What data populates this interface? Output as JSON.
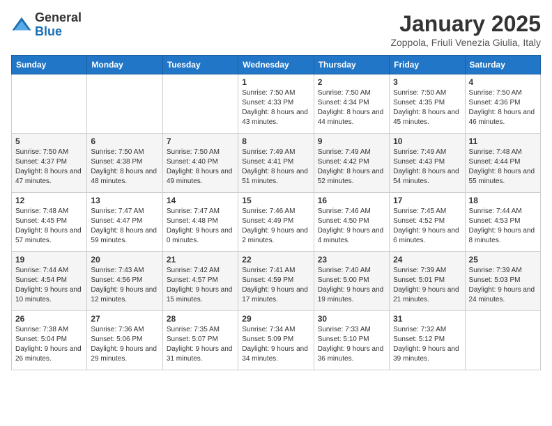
{
  "logo": {
    "general": "General",
    "blue": "Blue"
  },
  "header": {
    "month": "January 2025",
    "location": "Zoppola, Friuli Venezia Giulia, Italy"
  },
  "days_of_week": [
    "Sunday",
    "Monday",
    "Tuesday",
    "Wednesday",
    "Thursday",
    "Friday",
    "Saturday"
  ],
  "weeks": [
    [
      {
        "day": "",
        "info": ""
      },
      {
        "day": "",
        "info": ""
      },
      {
        "day": "",
        "info": ""
      },
      {
        "day": "1",
        "info": "Sunrise: 7:50 AM\nSunset: 4:33 PM\nDaylight: 8 hours and 43 minutes."
      },
      {
        "day": "2",
        "info": "Sunrise: 7:50 AM\nSunset: 4:34 PM\nDaylight: 8 hours and 44 minutes."
      },
      {
        "day": "3",
        "info": "Sunrise: 7:50 AM\nSunset: 4:35 PM\nDaylight: 8 hours and 45 minutes."
      },
      {
        "day": "4",
        "info": "Sunrise: 7:50 AM\nSunset: 4:36 PM\nDaylight: 8 hours and 46 minutes."
      }
    ],
    [
      {
        "day": "5",
        "info": "Sunrise: 7:50 AM\nSunset: 4:37 PM\nDaylight: 8 hours and 47 minutes."
      },
      {
        "day": "6",
        "info": "Sunrise: 7:50 AM\nSunset: 4:38 PM\nDaylight: 8 hours and 48 minutes."
      },
      {
        "day": "7",
        "info": "Sunrise: 7:50 AM\nSunset: 4:40 PM\nDaylight: 8 hours and 49 minutes."
      },
      {
        "day": "8",
        "info": "Sunrise: 7:49 AM\nSunset: 4:41 PM\nDaylight: 8 hours and 51 minutes."
      },
      {
        "day": "9",
        "info": "Sunrise: 7:49 AM\nSunset: 4:42 PM\nDaylight: 8 hours and 52 minutes."
      },
      {
        "day": "10",
        "info": "Sunrise: 7:49 AM\nSunset: 4:43 PM\nDaylight: 8 hours and 54 minutes."
      },
      {
        "day": "11",
        "info": "Sunrise: 7:48 AM\nSunset: 4:44 PM\nDaylight: 8 hours and 55 minutes."
      }
    ],
    [
      {
        "day": "12",
        "info": "Sunrise: 7:48 AM\nSunset: 4:45 PM\nDaylight: 8 hours and 57 minutes."
      },
      {
        "day": "13",
        "info": "Sunrise: 7:47 AM\nSunset: 4:47 PM\nDaylight: 8 hours and 59 minutes."
      },
      {
        "day": "14",
        "info": "Sunrise: 7:47 AM\nSunset: 4:48 PM\nDaylight: 9 hours and 0 minutes."
      },
      {
        "day": "15",
        "info": "Sunrise: 7:46 AM\nSunset: 4:49 PM\nDaylight: 9 hours and 2 minutes."
      },
      {
        "day": "16",
        "info": "Sunrise: 7:46 AM\nSunset: 4:50 PM\nDaylight: 9 hours and 4 minutes."
      },
      {
        "day": "17",
        "info": "Sunrise: 7:45 AM\nSunset: 4:52 PM\nDaylight: 9 hours and 6 minutes."
      },
      {
        "day": "18",
        "info": "Sunrise: 7:44 AM\nSunset: 4:53 PM\nDaylight: 9 hours and 8 minutes."
      }
    ],
    [
      {
        "day": "19",
        "info": "Sunrise: 7:44 AM\nSunset: 4:54 PM\nDaylight: 9 hours and 10 minutes."
      },
      {
        "day": "20",
        "info": "Sunrise: 7:43 AM\nSunset: 4:56 PM\nDaylight: 9 hours and 12 minutes."
      },
      {
        "day": "21",
        "info": "Sunrise: 7:42 AM\nSunset: 4:57 PM\nDaylight: 9 hours and 15 minutes."
      },
      {
        "day": "22",
        "info": "Sunrise: 7:41 AM\nSunset: 4:59 PM\nDaylight: 9 hours and 17 minutes."
      },
      {
        "day": "23",
        "info": "Sunrise: 7:40 AM\nSunset: 5:00 PM\nDaylight: 9 hours and 19 minutes."
      },
      {
        "day": "24",
        "info": "Sunrise: 7:39 AM\nSunset: 5:01 PM\nDaylight: 9 hours and 21 minutes."
      },
      {
        "day": "25",
        "info": "Sunrise: 7:39 AM\nSunset: 5:03 PM\nDaylight: 9 hours and 24 minutes."
      }
    ],
    [
      {
        "day": "26",
        "info": "Sunrise: 7:38 AM\nSunset: 5:04 PM\nDaylight: 9 hours and 26 minutes."
      },
      {
        "day": "27",
        "info": "Sunrise: 7:36 AM\nSunset: 5:06 PM\nDaylight: 9 hours and 29 minutes."
      },
      {
        "day": "28",
        "info": "Sunrise: 7:35 AM\nSunset: 5:07 PM\nDaylight: 9 hours and 31 minutes."
      },
      {
        "day": "29",
        "info": "Sunrise: 7:34 AM\nSunset: 5:09 PM\nDaylight: 9 hours and 34 minutes."
      },
      {
        "day": "30",
        "info": "Sunrise: 7:33 AM\nSunset: 5:10 PM\nDaylight: 9 hours and 36 minutes."
      },
      {
        "day": "31",
        "info": "Sunrise: 7:32 AM\nSunset: 5:12 PM\nDaylight: 9 hours and 39 minutes."
      },
      {
        "day": "",
        "info": ""
      }
    ]
  ]
}
